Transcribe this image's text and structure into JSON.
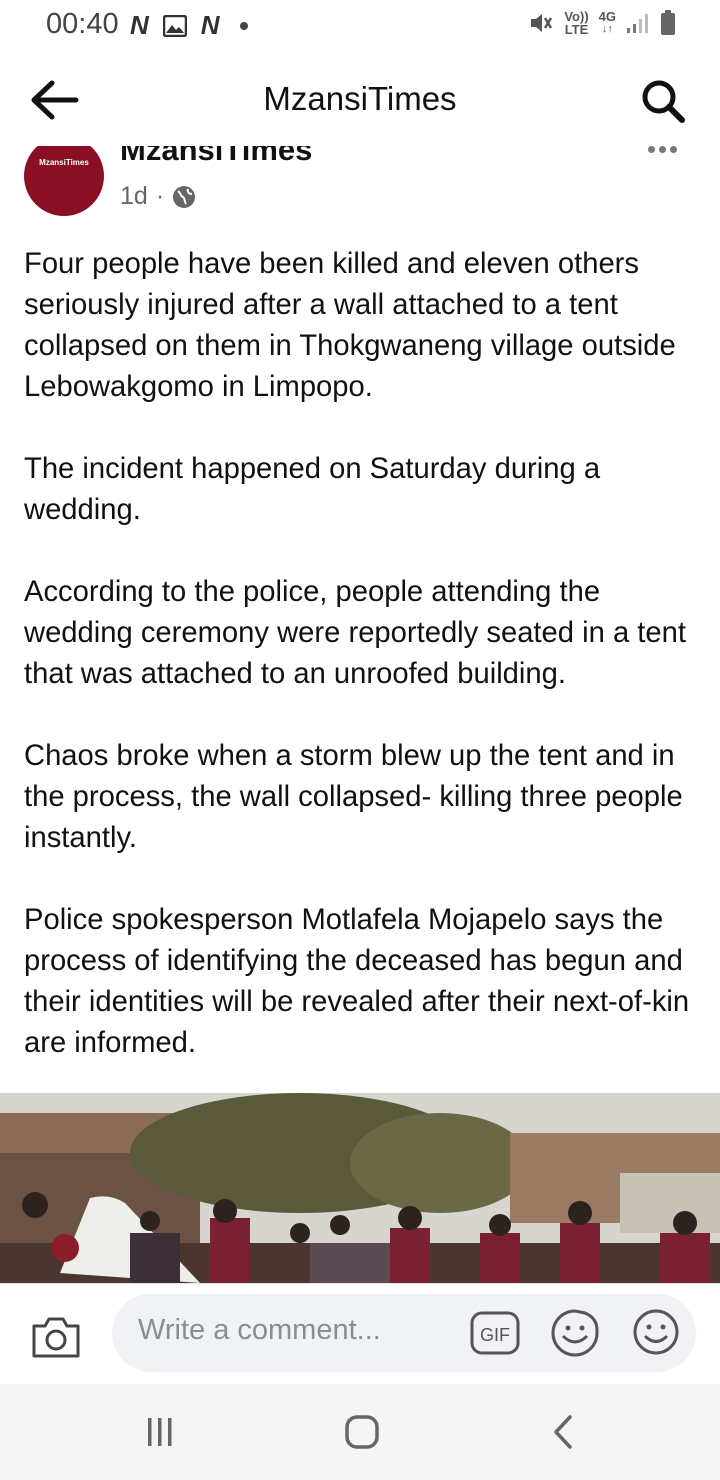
{
  "status_bar": {
    "time": "00:40",
    "left_icons": [
      "N",
      "N"
    ],
    "volte_label": "Vo))",
    "lte_label": "LTE",
    "network_label": "4G",
    "icons": [
      "mute-icon",
      "signal-icon",
      "battery-icon",
      "image-icon"
    ]
  },
  "app_bar": {
    "title": "MzansiTimes",
    "back_icon": "back-arrow-icon",
    "search_icon": "search-icon"
  },
  "post": {
    "author": "MzansiTimes",
    "avatar_text": "MzansiTimes",
    "age": "1d",
    "separator": "·",
    "privacy_icon": "globe-icon",
    "paragraphs": [
      "Four people have been killed and eleven others seriously injured after a wall attached to a tent collapsed on them in Thokgwaneng village outside Lebowakgomo in Limpopo.",
      "The incident happened on Saturday during a wedding.",
      "According to the police, people attending the wedding ceremony were reportedly seated in a tent that was attached to an unroofed building.",
      "Chaos broke when a storm blew up the tent and in the process, the wall collapsed- killing three people instantly.",
      "Police spokesperson Motlafela Mojapelo says the process of identifying the deceased has begun and their identities will be revealed after their next-of-kin are informed."
    ]
  },
  "comment_bar": {
    "placeholder": "Write a comment...",
    "gif_label": "GIF"
  },
  "colors": {
    "brand": "#8a0f24",
    "input_bg": "#f0f2f5",
    "placeholder": "#8a8d91"
  }
}
